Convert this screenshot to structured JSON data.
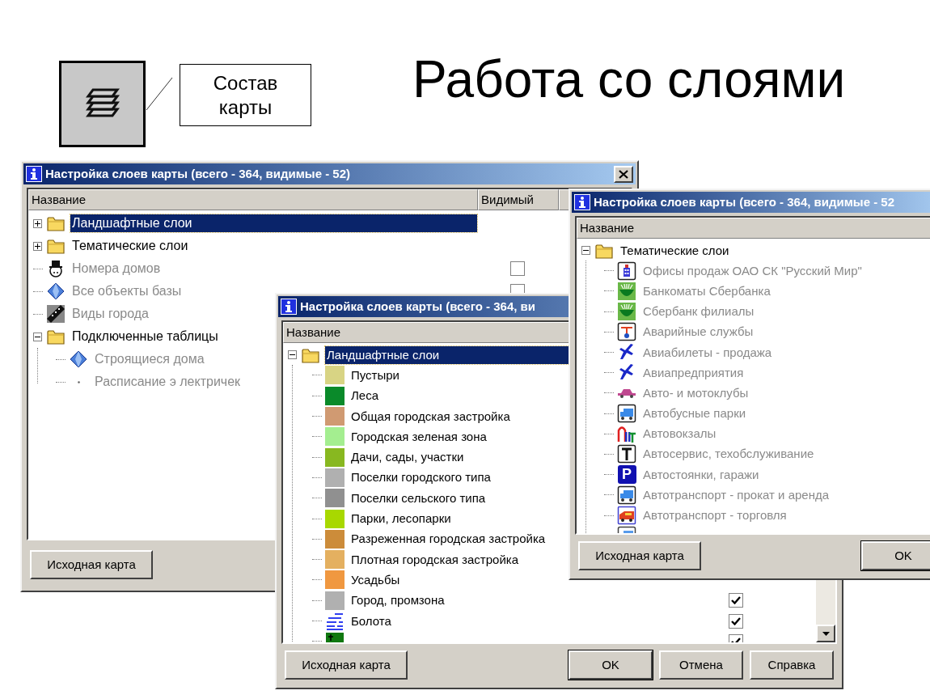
{
  "slide": {
    "title": "Работа со слоями",
    "callout": "Состав карты"
  },
  "windows": [
    {
      "title": "Настройка слоев карты (всего - 364, видимые - 52)",
      "closable": true,
      "columns": [
        "Название",
        "Видимый"
      ],
      "items": [
        {
          "label": "Ландшафтные слои",
          "kind": "folder",
          "expanded": false,
          "selected": true
        },
        {
          "label": "Тематические слои",
          "kind": "folder",
          "expanded": false,
          "selected": false,
          "dimmed": false
        },
        {
          "label": "Номера домов",
          "kind": "hat",
          "selected": false,
          "dimmed": true,
          "checked": false
        },
        {
          "label": "Все объекты базы",
          "kind": "gem",
          "selected": false,
          "dimmed": true,
          "checked": false
        },
        {
          "label": "Виды города",
          "kind": "film",
          "selected": false,
          "dimmed": true
        },
        {
          "label": "Подключенные таблицы",
          "kind": "folder",
          "expanded": true,
          "selected": false,
          "dimmed": false,
          "children": [
            {
              "label": "Строящиеся дома",
              "kind": "gem",
              "selected": false,
              "dimmed": true
            },
            {
              "label": "Расписание э лектричек",
              "kind": "dot",
              "selected": false,
              "dimmed": true
            }
          ]
        }
      ],
      "buttons": [
        {
          "label": "Исходная карта",
          "default": false
        }
      ]
    },
    {
      "title": "Настройка слоев карты (всего - 364, ви",
      "columns": [
        "Название"
      ],
      "scrollbar": true,
      "items": [
        {
          "label": "Ландшафтные слои",
          "kind": "folder",
          "expanded": true,
          "selected": true,
          "children": [
            {
              "label": "Пустыри",
              "kind": "swatch",
              "color": "#d8d484",
              "selected": false,
              "dimmed": false
            },
            {
              "label": "Леса",
              "kind": "swatch",
              "color": "#0a8a2a",
              "selected": false,
              "dimmed": false
            },
            {
              "label": "Общая городская застройка",
              "kind": "swatch",
              "color": "#d09a72",
              "selected": false,
              "dimmed": false
            },
            {
              "label": "Городская зеленая зона",
              "kind": "swatch",
              "color": "#a4ee90",
              "selected": false,
              "dimmed": false
            },
            {
              "label": "Дачи, сады, участки",
              "kind": "swatch",
              "color": "#88b820",
              "selected": false,
              "dimmed": false
            },
            {
              "label": "Поселки городского типа",
              "kind": "swatch",
              "color": "#b0b0b0",
              "selected": false,
              "dimmed": false
            },
            {
              "label": "Поселки сельского типа",
              "kind": "swatch",
              "color": "#909090",
              "selected": false,
              "dimmed": false
            },
            {
              "label": "Парки, лесопарки",
              "kind": "swatch",
              "color": "#a8d800",
              "selected": false,
              "dimmed": false
            },
            {
              "label": "Разреженная городская застройка",
              "kind": "swatch",
              "color": "#cc8c3a",
              "selected": false,
              "dimmed": false
            },
            {
              "label": "Плотная городская застройка",
              "kind": "swatch",
              "color": "#e4b060",
              "selected": false,
              "dimmed": false
            },
            {
              "label": "Усадьбы",
              "kind": "swatch",
              "color": "#f09840",
              "selected": false,
              "dimmed": false
            },
            {
              "label": "Город, промзона",
              "kind": "swatch",
              "color": "#b0b0b0",
              "selected": false,
              "dimmed": false,
              "checked": true
            },
            {
              "label": "Болота",
              "kind": "marsh",
              "selected": false,
              "dimmed": false,
              "checked": true
            },
            {
              "kind": "cemetery",
              "selected": false,
              "dimmed": false,
              "checked": true
            }
          ]
        }
      ],
      "buttons": [
        {
          "label": "Исходная карта",
          "default": false
        },
        {
          "label": "OK",
          "default": true
        },
        {
          "label": "Отмена",
          "default": false
        },
        {
          "label": "Справка",
          "default": false
        }
      ]
    },
    {
      "title": "Настройка слоев карты (всего - 364, видимые - 52",
      "columns": [
        "Название"
      ],
      "items": [
        {
          "label": "Тематические слои",
          "kind": "folder",
          "expanded": true,
          "selected": false,
          "dimmed": false,
          "children": [
            {
              "label": "Офисы продаж ОАО СК \"Русский Мир\"",
              "kind": "office",
              "selected": false,
              "dimmed": true
            },
            {
              "label": "Банкоматы Сбербанка",
              "kind": "emblem",
              "selected": false,
              "dimmed": true
            },
            {
              "label": "Сбербанк филиалы",
              "kind": "emblem",
              "selected": false,
              "dimmed": true
            },
            {
              "label": "Аварийные службы",
              "kind": "emergency",
              "selected": false,
              "dimmed": true
            },
            {
              "label": "Авиабилеты - продажа",
              "kind": "plane",
              "selected": false,
              "dimmed": true
            },
            {
              "label": "Авиапредприятия",
              "kind": "plane",
              "selected": false,
              "dimmed": true
            },
            {
              "label": "Авто- и мотоклубы",
              "kind": "car",
              "selected": false,
              "dimmed": true
            },
            {
              "label": "Автобусные парки",
              "kind": "truck",
              "selected": false,
              "dimmed": true
            },
            {
              "label": "Автовокзалы",
              "kind": "arch",
              "selected": false,
              "dimmed": true
            },
            {
              "label": "Автосервис, техобслуживание",
              "kind": "tool",
              "selected": false,
              "dimmed": true
            },
            {
              "label": "Автостоянки, гаражи",
              "kind": "parking",
              "icon_text": "P",
              "selected": false,
              "dimmed": true
            },
            {
              "label": "Автотранспорт - прокат и аренда",
              "kind": "truck",
              "selected": false,
              "dimmed": true
            },
            {
              "label": "Автотранспорт - торговля",
              "kind": "van",
              "selected": false,
              "dimmed": true
            },
            {
              "kind": "truck",
              "selected": false,
              "dimmed": true
            }
          ]
        }
      ],
      "buttons": [
        {
          "label": "Исходная карта",
          "default": false
        },
        {
          "label": "OK",
          "default": true
        }
      ]
    }
  ]
}
